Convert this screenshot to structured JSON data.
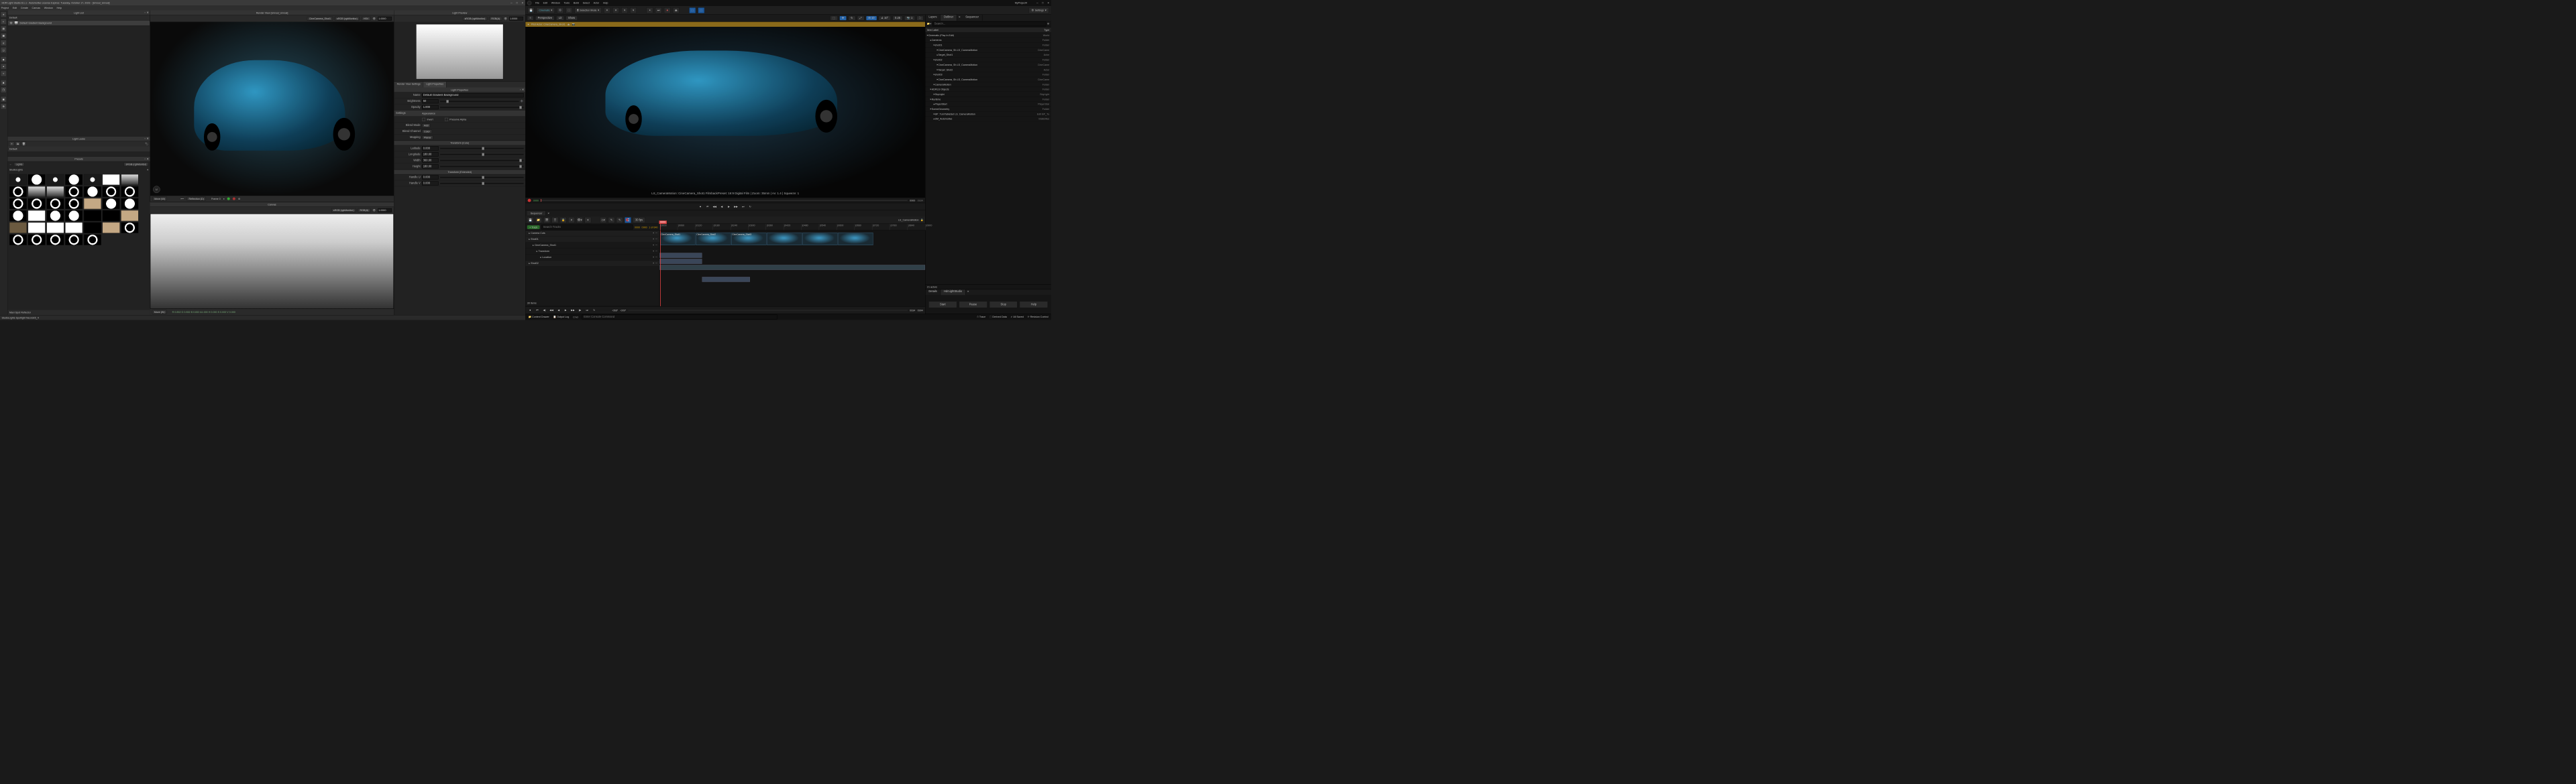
{
  "hdr": {
    "title": "HDR Light Studio 8.1.1 - Automotive License Expires: Tuesday, October 17, 2023 - [Unreal_Unreal]",
    "menus": [
      "Project",
      "Edit",
      "Create",
      "Canvas",
      "Window",
      "Help"
    ],
    "lightlist": {
      "title": "Light List",
      "defaultTab": "Default",
      "rowName": "Default Gradient Background"
    },
    "looks": {
      "title": "Light Looks",
      "tab": "Default"
    },
    "presets": {
      "title": "Presets",
      "src": "Lights",
      "colorspace": "sRGB (rgbMonitor)",
      "category": "StudioLights"
    },
    "renderView": {
      "title": "Render View [Unreal_Unreal]",
      "camera": "CineCamera_Shot1",
      "colorsp": "sRGB (rgbMonitor)",
      "mode": "HSV",
      "val": "1.0000",
      "move": "Move (W)",
      "reflect": "Reflection (D)",
      "frame": "Frame 0"
    },
    "canvas": {
      "title": "Canvas",
      "colorsp": "sRGB (rgbMonitor)",
      "mode": "RGB(A)",
      "val": "1.0000",
      "move": "Move (W)",
      "readout": "R 0.832 G 0.832 B 0.832 A1.000    H 0.000 S 0.000 V 0.000"
    },
    "lightPreview": {
      "title": "Light Preview",
      "colorsp": "sRGB (rgbMonitor)",
      "mode": "RGB(A)",
      "val": "1.0000"
    },
    "tabs": {
      "a": "Render View Settings",
      "b": "Light Properties"
    },
    "props": {
      "title": "Light Properties",
      "name": "Default Gradient Background",
      "nameLbl": "Name",
      "brightness": "50",
      "brightnessLbl": "Brightness",
      "opacity": "1.000",
      "opacityLbl": "Opacity",
      "sett": "Settings",
      "appear": "Appearance",
      "invert": "Invert",
      "preserve": "Preserve Alpha",
      "blendMode": "Add",
      "blendModeLbl": "Blend Mode",
      "blendCh": "Color",
      "blendChLbl": "Blend Channel",
      "mapping": "Planar",
      "mappingLbl": "Mapping",
      "tcore": "Transform (Core)",
      "lat": "0.000",
      "latLbl": "Latitude",
      "lon": "180.00",
      "lonLbl": "Longitude",
      "wid": "360.00",
      "widLbl": "Width",
      "hei": "180.00",
      "heiLbl": "Height",
      "text": "Transform (Extended)",
      "hu": "0.000",
      "huLbl": "Handle U",
      "hv": "0.000",
      "hvLbl": "Handle V"
    },
    "status": "StudioLights Spotlight Neon3x5_4",
    "presetHover": "Maxi Spot Reflector"
  },
  "ue": {
    "menus": [
      "File",
      "Edit",
      "Window",
      "Tools",
      "Build",
      "Select",
      "Actor",
      "Help"
    ],
    "project": "MyProject4",
    "mode": "Cinematic",
    "selection": "Selection Mode",
    "vp": {
      "persp": "Perspective",
      "lit": "Lit",
      "show": "Show"
    },
    "pilot": "Pilot Actor: CineCamera_Shot1",
    "hud": "LS_CameraMotion: CineCamera_Shot1        FilmbackPreset: 16:9 Digital Film | Zoom: 35mm | Av: 1.4 | Squeeze: 1",
    "settings": "Settings",
    "frameStart": "0000",
    "frameEnd": "0900",
    "frameEndR": "0934",
    "seq": {
      "tab": "Sequencer",
      "addTrack": "+ Track",
      "searchPh": "Search Tracks",
      "range1": "0000",
      "range2": "0900",
      "range3": "1 of 640",
      "name": "LS_CameraMotion",
      "fps": "30 fps",
      "tracks": [
        {
          "name": "Camera Cuts",
          "ind": 0,
          "head": true
        },
        {
          "name": "Shot01",
          "ind": 0,
          "head": true
        },
        {
          "name": "CineCamera_Shot1",
          "ind": 1
        },
        {
          "name": "Transform",
          "ind": 2
        },
        {
          "name": "Location",
          "ind": 3
        },
        {
          "name": "Shot02",
          "ind": 0,
          "head": true
        }
      ],
      "shots": [
        "CineCamera_Shot1",
        "CineCamera_Shot2",
        "CineCamera_Shot3"
      ],
      "items": "30 items",
      "footL": "-068*",
      "footL2": "-009*",
      "footR": "0934",
      "footR2": "0994"
    },
    "outliner": {
      "tabs": [
        "Layers",
        "Outliner",
        "Sequencer"
      ],
      "activeTab": 1,
      "cols": [
        "Item Label",
        "Type"
      ],
      "searchPh": "Search...",
      "rows": [
        {
          "n": "Cinematic  (Play In Edit)",
          "t": "World",
          "i": 0
        },
        {
          "n": "Cameras",
          "t": "Folder",
          "i": 1
        },
        {
          "n": "shot01",
          "t": "Folder",
          "i": 2
        },
        {
          "n": "CineCamera_Sh     LS_CameraMotion",
          "t": "CineCame",
          "i": 3
        },
        {
          "n": "Target_Shot1",
          "t": "Actor",
          "i": 3
        },
        {
          "n": "shot02",
          "t": "Folder",
          "i": 2
        },
        {
          "n": "CineCamera_Sh     LS_CameraMotion",
          "t": "CineCame",
          "i": 3
        },
        {
          "n": "Target_Shot2",
          "t": "Actor",
          "i": 3
        },
        {
          "n": "shot03",
          "t": "Folder",
          "i": 2
        },
        {
          "n": "CineCamera_Sh     LS_CameraMotion",
          "t": "CineCame",
          "i": 3
        },
        {
          "n": "CameraMotion",
          "t": "Folder",
          "i": 2
        },
        {
          "n": "HDRLS Objects",
          "t": "Folder",
          "i": 1
        },
        {
          "n": "SkyLight",
          "t": "SkyLight",
          "i": 2
        },
        {
          "n": "Runtime",
          "t": "Folder",
          "i": 1
        },
        {
          "n": "PlayerStart",
          "t": "PlayerStar",
          "i": 2
        },
        {
          "n": "SceneGeometry",
          "t": "Folder",
          "i": 1
        },
        {
          "n": "BP_TurnTableSet   LS_CameraMotion",
          "t": "Edit BP_Tu",
          "i": 2
        },
        {
          "n": "SM_Automotive",
          "t": "StaticMes",
          "i": 2
        }
      ],
      "count": "21 actors"
    },
    "details": {
      "tab1": "Details",
      "tab2": "HdrLightStudio",
      "btns": [
        "Start",
        "Pause",
        "Stop",
        "Help"
      ]
    },
    "status": {
      "drawer": "Content Drawer",
      "log": "Output Log",
      "cmd": "Cmd",
      "cmdPh": "Enter Console Command",
      "trace": "Trace",
      "derived": "Derived Data",
      "saved": "All Saved",
      "rev": "Revision Control"
    }
  }
}
